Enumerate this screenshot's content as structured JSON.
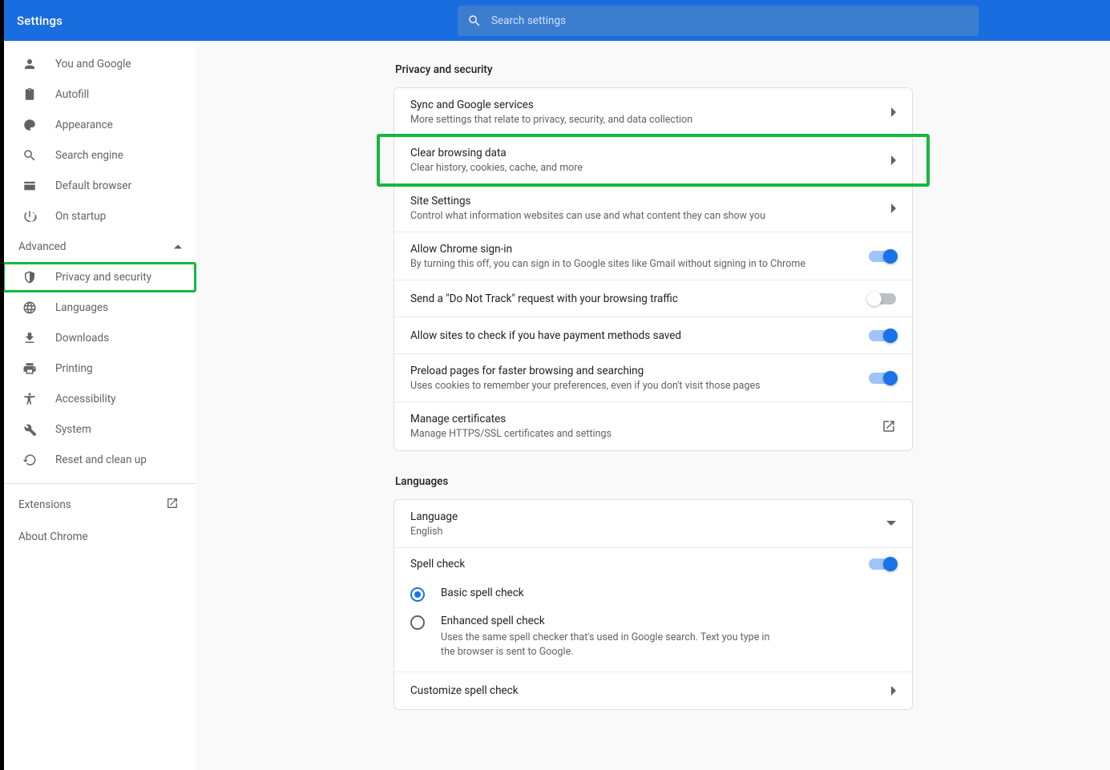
{
  "header": {
    "title": "Settings",
    "search_placeholder": "Search settings"
  },
  "sidebar": {
    "items": [
      {
        "label": "You and Google",
        "icon": "person"
      },
      {
        "label": "Autofill",
        "icon": "assignment"
      },
      {
        "label": "Appearance",
        "icon": "palette"
      },
      {
        "label": "Search engine",
        "icon": "search"
      },
      {
        "label": "Default browser",
        "icon": "browser"
      },
      {
        "label": "On startup",
        "icon": "power"
      }
    ],
    "advanced_label": "Advanced",
    "advanced_items": [
      {
        "label": "Privacy and security",
        "icon": "shield"
      },
      {
        "label": "Languages",
        "icon": "globe"
      },
      {
        "label": "Downloads",
        "icon": "download"
      },
      {
        "label": "Printing",
        "icon": "print"
      },
      {
        "label": "Accessibility",
        "icon": "accessibility"
      },
      {
        "label": "System",
        "icon": "wrench"
      },
      {
        "label": "Reset and clean up",
        "icon": "restore"
      }
    ],
    "extensions": "Extensions",
    "about": "About Chrome"
  },
  "privacy": {
    "section_title": "Privacy and security",
    "rows": [
      {
        "title": "Sync and Google services",
        "sub": "More settings that relate to privacy, security, and data collection"
      },
      {
        "title": "Clear browsing data",
        "sub": "Clear history, cookies, cache, and more"
      },
      {
        "title": "Site Settings",
        "sub": "Control what information websites can use and what content they can show you"
      },
      {
        "title": "Allow Chrome sign-in",
        "sub": "By turning this off, you can sign in to Google sites like Gmail without signing in to Chrome"
      },
      {
        "title": "Send a \"Do Not Track\" request with your browsing traffic"
      },
      {
        "title": "Allow sites to check if you have payment methods saved"
      },
      {
        "title": "Preload pages for faster browsing and searching",
        "sub": "Uses cookies to remember your preferences, even if you don't visit those pages"
      },
      {
        "title": "Manage certificates",
        "sub": "Manage HTTPS/SSL certificates and settings"
      }
    ]
  },
  "languages": {
    "section_title": "Languages",
    "language_label": "Language",
    "language_value": "English",
    "spell_check_label": "Spell check",
    "basic": "Basic spell check",
    "enhanced": "Enhanced spell check",
    "enhanced_sub": "Uses the same spell checker that's used in Google search. Text you type in the browser is sent to Google.",
    "customize": "Customize spell check"
  }
}
